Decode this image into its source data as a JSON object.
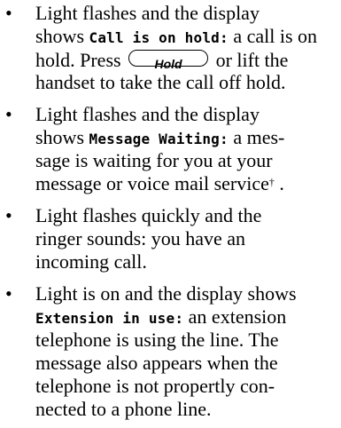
{
  "bullet_glyph": "•",
  "items": [
    {
      "lines": {
        "l1": "Light flashes and the display",
        "l2_pre": "shows ",
        "l2_lcd": "Call is on hold:",
        "l2_post": " a call is on",
        "l3_pre": "hold. Press ",
        "l3_key": "Hold",
        "l3_post": " or lift the",
        "l4": "handset to take the call off hold."
      }
    },
    {
      "lines": {
        "l1": "Light flashes and the display",
        "l2_pre": "shows ",
        "l2_lcd": "Message Waiting:",
        "l2_post": " a mes-",
        "l3": "sage is waiting for you at your",
        "l4_pre": "message or voice mail service",
        "l4_sup": "†",
        "l4_post": " ."
      }
    },
    {
      "lines": {
        "l1": "Light flashes quickly and the",
        "l2": "ringer sounds: you have an",
        "l3": "incoming call."
      }
    },
    {
      "lines": {
        "l1": "Light is on and the display shows",
        "l2_lcd": "Extension in use:",
        "l2_post": " an extension",
        "l3": "telephone is using the line. The",
        "l4": "message also appears when the",
        "l5": "telephone is not propertly con-",
        "l6": "nected to a phone line."
      }
    }
  ]
}
